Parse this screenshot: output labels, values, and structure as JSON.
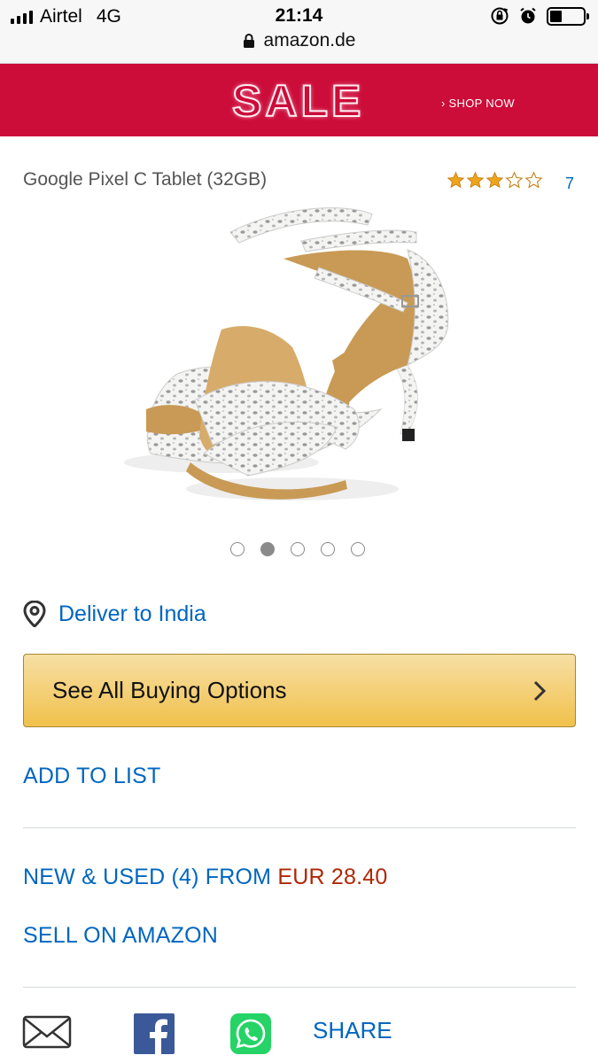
{
  "status_bar": {
    "carrier": "Airtel",
    "network": "4G",
    "time": "21:14",
    "url": "amazon.de",
    "battery_level": 0.35
  },
  "banner": {
    "sale_text": "SALE",
    "shop_now": "› SHOP NOW",
    "background_color": "#cc0c39"
  },
  "product": {
    "title": "Google Pixel C Tablet (32GB)",
    "rating": 3,
    "rating_max": 5,
    "review_count": "7",
    "image_icon": "sandal-image",
    "carousel": {
      "total": 5,
      "active_index": 1
    }
  },
  "delivery": {
    "icon": "location-pin-icon",
    "label": "Deliver to India"
  },
  "buy_button": {
    "label": "See All Buying Options",
    "icon": "chevron-right-icon"
  },
  "links": {
    "add_to_list": "ADD TO LIST",
    "new_used_prefix": "NEW & USED (4) FROM",
    "new_used_price": "EUR 28.40",
    "sell_on": "SELL ON AMAZON"
  },
  "share": {
    "icons": [
      "mail-icon",
      "facebook-icon",
      "whatsapp-icon"
    ],
    "label": "SHARE"
  },
  "colors": {
    "link": "#0066c0",
    "price": "#b12704",
    "star": "#f0a41c",
    "button_top": "#f7dfa5",
    "button_bottom": "#f0c14b"
  }
}
